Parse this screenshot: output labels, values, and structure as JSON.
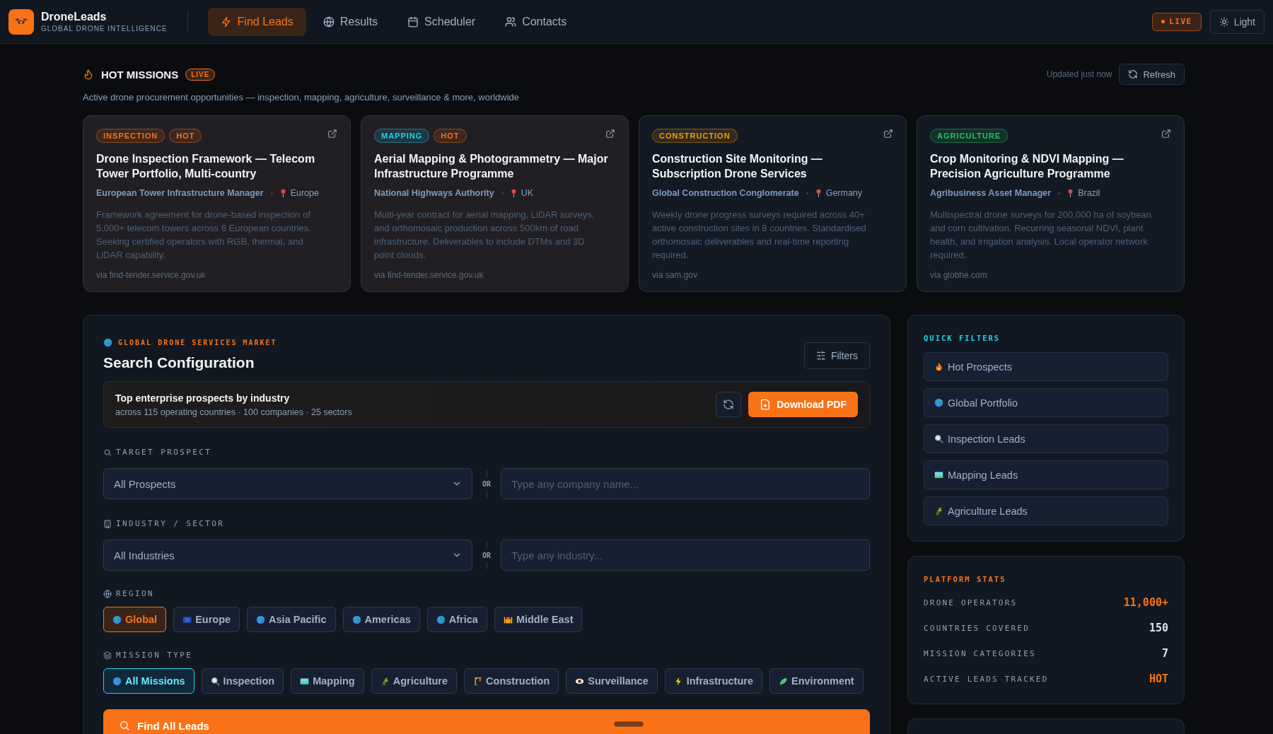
{
  "app": {
    "name": "DroneLeads",
    "tagline": "GLOBAL DRONE INTELLIGENCE"
  },
  "nav": [
    {
      "label": "Find Leads",
      "kind": "bolt",
      "selected": true
    },
    {
      "label": "Results",
      "kind": "globe",
      "selected": false
    },
    {
      "label": "Scheduler",
      "kind": "calendar",
      "selected": false
    },
    {
      "label": "Contacts",
      "kind": "users",
      "selected": false
    }
  ],
  "live_badge": "LIVE",
  "theme_button": "Light",
  "hot_missions": {
    "title": "HOT MISSIONS",
    "badge": "LIVE",
    "updated": "Updated just now",
    "refresh": "Refresh",
    "subtitle": "Active drone procurement opportunities — inspection, mapping, agriculture, surveillance & more, worldwide",
    "cards": [
      {
        "highlighted": true,
        "tags": [
          {
            "label": "INSPECTION",
            "kind": "inspection"
          },
          {
            "label": "HOT",
            "kind": "hot"
          }
        ],
        "title": "Drone Inspection Framework — Telecom Tower Portfolio, Multi-country",
        "buyer": "European Tower Infrastructure Manager",
        "location": "Europe",
        "description": "Framework agreement for drone-based inspection of 5,000+ telecom towers across 6 European countries. Seeking certified operators with RGB, thermal, and LiDAR capability.",
        "source": "via find-tender.service.gov.uk"
      },
      {
        "highlighted": true,
        "tags": [
          {
            "label": "MAPPING",
            "kind": "mapping"
          },
          {
            "label": "HOT",
            "kind": "hot"
          }
        ],
        "title": "Aerial Mapping & Photogrammetry — Major Infrastructure Programme",
        "buyer": "National Highways Authority",
        "location": "UK",
        "description": "Multi-year contract for aerial mapping, LiDAR surveys, and orthomosaic production across 500km of road infrastructure. Deliverables to include DTMs and 3D point clouds.",
        "source": "via find-tender.service.gov.uk"
      },
      {
        "highlighted": false,
        "tags": [
          {
            "label": "CONSTRUCTION",
            "kind": "construction"
          }
        ],
        "title": "Construction Site Monitoring — Subscription Drone Services",
        "buyer": "Global Construction Conglomerate",
        "location": "Germany",
        "description": "Weekly drone progress surveys required across 40+ active construction sites in 8 countries. Standardised orthomosaic deliverables and real-time reporting required.",
        "source": "via sam.gov"
      },
      {
        "highlighted": false,
        "tags": [
          {
            "label": "AGRICULTURE",
            "kind": "agriculture"
          }
        ],
        "title": "Crop Monitoring & NDVI Mapping — Precision Agriculture Programme",
        "buyer": "Agribusiness Asset Manager",
        "location": "Brazil",
        "description": "Multispectral drone surveys for 200,000 ha of soybean and corn cultivation. Recurring seasonal NDVI, plant health, and irrigation analysis. Local operator network required.",
        "source": "via globhe.com"
      }
    ]
  },
  "search": {
    "eyebrow": "GLOBAL DRONE SERVICES MARKET",
    "title": "Search Configuration",
    "filters_button": "Filters",
    "summary": {
      "title": "Top enterprise prospects by industry",
      "meta": "across 115 operating countries · 100 companies · 25 sectors"
    },
    "download_button": "Download PDF",
    "fields": [
      {
        "label": "TARGET PROSPECT",
        "kind": "search",
        "select": "All Prospects",
        "or": "OR",
        "placeholder": "Type any company name..."
      },
      {
        "label": "INDUSTRY / SECTOR",
        "kind": "building",
        "select": "All Industries",
        "or": "OR",
        "placeholder": "Type any industry..."
      }
    ],
    "region": {
      "label": "REGION",
      "options": [
        {
          "label": "Global",
          "kind": "globe",
          "selected": true
        },
        {
          "label": "Europe",
          "kind": "flag",
          "selected": false
        },
        {
          "label": "Asia Pacific",
          "kind": "globe",
          "selected": false
        },
        {
          "label": "Americas",
          "kind": "globe",
          "selected": false
        },
        {
          "label": "Africa",
          "kind": "globe",
          "selected": false
        },
        {
          "label": "Middle East",
          "kind": "mosque",
          "selected": false
        }
      ]
    },
    "mission_type": {
      "label": "MISSION TYPE",
      "options": [
        {
          "label": "All Missions",
          "kind": "globe",
          "selected": true
        },
        {
          "label": "Inspection",
          "kind": "magnifier",
          "selected": false
        },
        {
          "label": "Mapping",
          "kind": "map",
          "selected": false
        },
        {
          "label": "Agriculture",
          "kind": "wheat",
          "selected": false
        },
        {
          "label": "Construction",
          "kind": "crane",
          "selected": false
        },
        {
          "label": "Surveillance",
          "kind": "eye",
          "selected": false
        },
        {
          "label": "Infrastructure",
          "kind": "bolt",
          "selected": false
        },
        {
          "label": "Environment",
          "kind": "leaf",
          "selected": false
        }
      ]
    },
    "find_button": "Find All Leads"
  },
  "quick_filters": {
    "title": "QUICK FILTERS",
    "items": [
      {
        "label": "Hot Prospects",
        "kind": "fire"
      },
      {
        "label": "Global Portfolio",
        "kind": "globe"
      },
      {
        "label": "Inspection Leads",
        "kind": "magnifier"
      },
      {
        "label": "Mapping Leads",
        "kind": "map"
      },
      {
        "label": "Agriculture Leads",
        "kind": "wheat"
      }
    ]
  },
  "platform_stats": {
    "title": "PLATFORM STATS",
    "rows": [
      {
        "label": "DRONE OPERATORS",
        "value": "11,000+",
        "kind": "accent"
      },
      {
        "label": "COUNTRIES COVERED",
        "value": "150",
        "kind": "plain"
      },
      {
        "label": "MISSION CATEGORIES",
        "value": "7",
        "kind": "plain"
      },
      {
        "label": "ACTIVE LEADS TRACKED",
        "value": "HOT",
        "kind": "accent"
      }
    ]
  }
}
